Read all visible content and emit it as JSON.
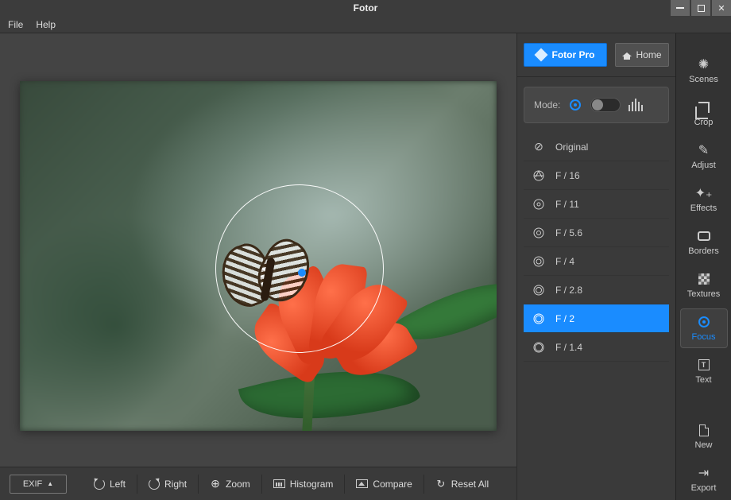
{
  "app": {
    "title": "Fotor"
  },
  "menu": {
    "file": "File",
    "help": "Help"
  },
  "topbar": {
    "pro_label": "Fotor Pro",
    "home_label": "Home"
  },
  "mode": {
    "label": "Mode:"
  },
  "apertures": {
    "items": [
      {
        "label": "Original"
      },
      {
        "label": "F / 16"
      },
      {
        "label": "F / 11"
      },
      {
        "label": "F / 5.6"
      },
      {
        "label": "F / 4"
      },
      {
        "label": "F / 2.8"
      },
      {
        "label": "F / 2"
      },
      {
        "label": "F / 1.4"
      }
    ],
    "active_index": 6
  },
  "tools": {
    "items": [
      {
        "label": "Scenes"
      },
      {
        "label": "Crop"
      },
      {
        "label": "Adjust"
      },
      {
        "label": "Effects"
      },
      {
        "label": "Borders"
      },
      {
        "label": "Textures"
      },
      {
        "label": "Focus"
      },
      {
        "label": "Text"
      },
      {
        "label": "New"
      },
      {
        "label": "Export"
      }
    ],
    "active_index": 6
  },
  "bottombar": {
    "exif": "EXIF",
    "left": "Left",
    "right": "Right",
    "zoom": "Zoom",
    "histogram": "Histogram",
    "compare": "Compare",
    "reset": "Reset All"
  }
}
